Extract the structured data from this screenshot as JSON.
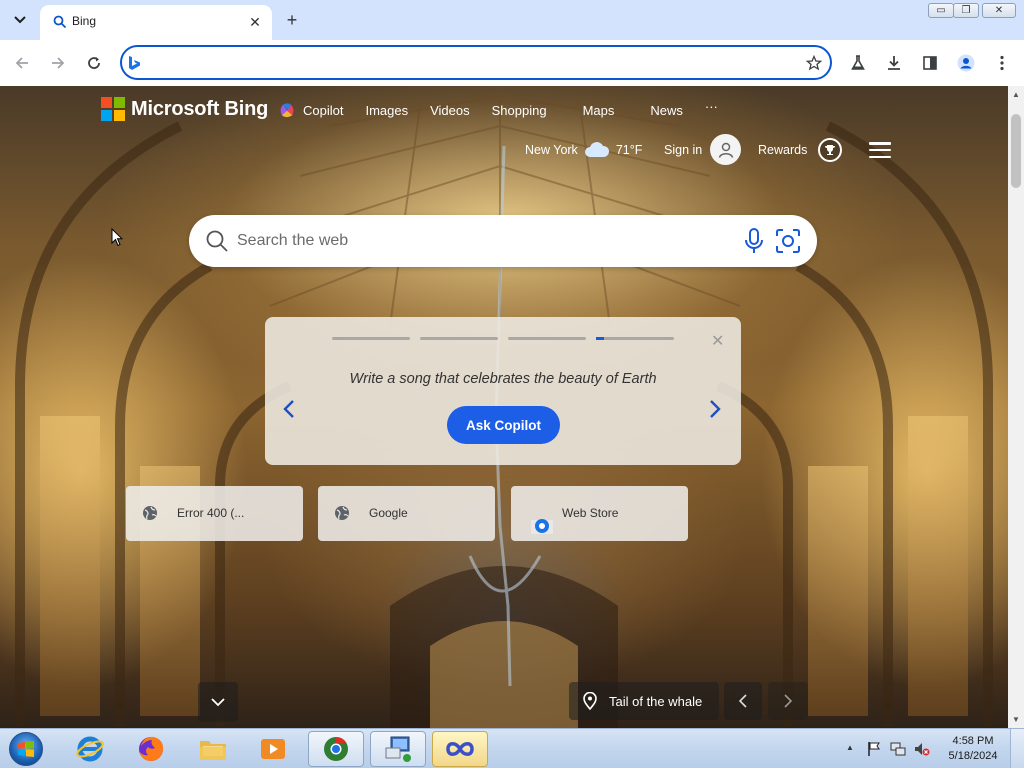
{
  "browser": {
    "tab_title": "Bing",
    "tab_close": "✕",
    "new_tab": "+",
    "address_value": "",
    "window_buttons": {
      "minimize": "▭",
      "maximize": "❐",
      "close": "✕"
    }
  },
  "bing": {
    "logo_text": "Microsoft Bing",
    "nav": [
      "Copilot",
      "Images",
      "Videos",
      "Shopping",
      "Maps",
      "News",
      "···"
    ],
    "weather": {
      "city": "New York",
      "temp": "71°F"
    },
    "signin": "Sign in",
    "rewards": "Rewards",
    "search_placeholder": "Search the web",
    "copilot_card": {
      "prompt": "Write a song that celebrates the beauty of Earth",
      "button": "Ask Copilot",
      "close": "✕",
      "progress_segments": 4,
      "active_segment": 4
    },
    "quick_links": [
      {
        "label": "Error 400 (...",
        "icon": "globe-icon"
      },
      {
        "label": "Google",
        "icon": "globe-icon"
      },
      {
        "label": "Web Store",
        "icon": "chrome-web-store-icon"
      }
    ],
    "image_caption": "Tail of the whale"
  },
  "taskbar": {
    "clock_time": "4:58 PM",
    "clock_date": "5/18/2024",
    "apps": [
      "internet-explorer",
      "firefox",
      "file-explorer",
      "media-player",
      "chrome",
      "network-app",
      "infinity-app"
    ]
  },
  "colors": {
    "accent": "#0b57d0",
    "bing_button": "#1c5ee5",
    "tabstrip": "#d3e3fd"
  }
}
